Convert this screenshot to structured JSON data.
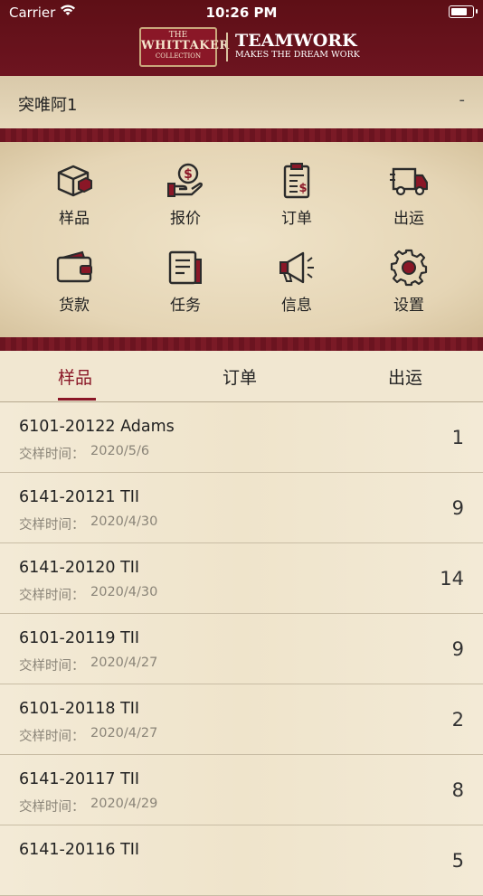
{
  "status_bar": {
    "carrier": "Carrier",
    "time": "10:26 PM"
  },
  "header": {
    "logo_line1": "THE",
    "logo_line2": "WHITTAKER",
    "logo_line3": "COLLECTION",
    "tagline_title": "TEAMWORK",
    "tagline_sub": "MAKES THE DREAM WORK"
  },
  "project": {
    "name": "突唯阿1",
    "trailing": "-"
  },
  "menu": [
    {
      "label": "样品",
      "icon": "box-icon"
    },
    {
      "label": "报价",
      "icon": "dollar-hand-icon"
    },
    {
      "label": "订单",
      "icon": "clipboard-dollar-icon"
    },
    {
      "label": "出运",
      "icon": "truck-icon"
    },
    {
      "label": "货款",
      "icon": "wallet-icon"
    },
    {
      "label": "任务",
      "icon": "document-icon"
    },
    {
      "label": "信息",
      "icon": "megaphone-icon"
    },
    {
      "label": "设置",
      "icon": "gear-icon"
    }
  ],
  "tabs": [
    {
      "label": "样品",
      "active": true
    },
    {
      "label": "订单",
      "active": false
    },
    {
      "label": "出运",
      "active": false
    }
  ],
  "date_label": "交样时间：",
  "rows": [
    {
      "title": "6101-20122 Adams",
      "date": "2020/5/6",
      "count": "1"
    },
    {
      "title": "6141-20121 TII",
      "date": "2020/4/30",
      "count": "9"
    },
    {
      "title": "6141-20120 TII",
      "date": "2020/4/30",
      "count": "14"
    },
    {
      "title": "6101-20119 TII",
      "date": "2020/4/27",
      "count": "9"
    },
    {
      "title": "6101-20118 TII",
      "date": "2020/4/27",
      "count": "2"
    },
    {
      "title": "6141-20117 TII",
      "date": "2020/4/29",
      "count": "8"
    },
    {
      "title": "6141-20116 TII",
      "date": "",
      "count": "5"
    }
  ],
  "colors": {
    "brand": "#8a1727",
    "header": "#6d1420",
    "background": "#f1e7d1"
  }
}
